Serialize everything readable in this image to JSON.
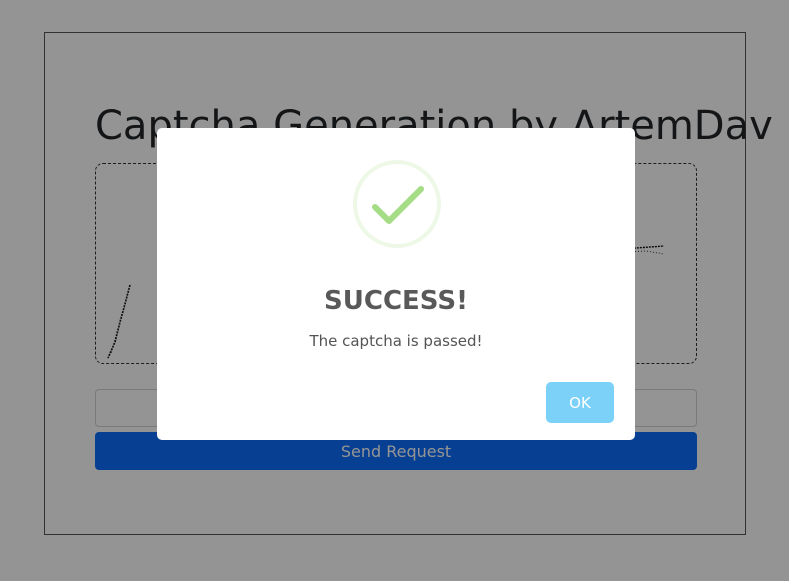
{
  "page": {
    "title": "Captcha Generation by ArtemDav",
    "input_value": "",
    "input_placeholder": "",
    "send_button_label": "Send Request"
  },
  "modal": {
    "icon": "success-check-icon",
    "title": "SUCCESS!",
    "message": "The captcha is passed!",
    "ok_label": "OK"
  },
  "colors": {
    "send_button": "#0d6efd",
    "ok_button": "#7cd1f9",
    "success_green": "#a5dc86",
    "success_ring": "rgba(165,220,134,0.2)"
  }
}
